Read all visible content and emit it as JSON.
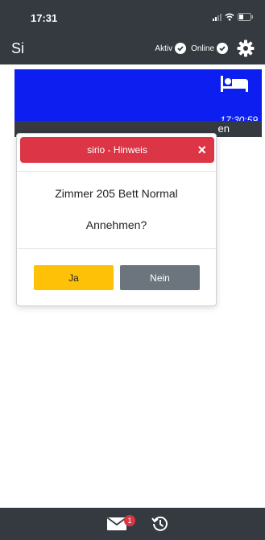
{
  "status_bar": {
    "time": "17:31"
  },
  "header": {
    "title": "Si",
    "aktiv_label": "Aktiv",
    "online_label": "Online"
  },
  "card": {
    "time": "17:30:59",
    "strip_text": "en"
  },
  "dialog": {
    "title": "sirio - Hinweis",
    "close": "×",
    "message": "Zimmer 205 Bett Normal",
    "question": "Annehmen?",
    "accept_label": "Ja",
    "decline_label": "Nein"
  },
  "footer": {
    "mail_count": "1"
  },
  "colors": {
    "header_bg": "#343a40",
    "card_blue": "#0d1ff0",
    "danger": "#dc3545",
    "warning": "#ffc107",
    "secondary": "#6c757d"
  }
}
